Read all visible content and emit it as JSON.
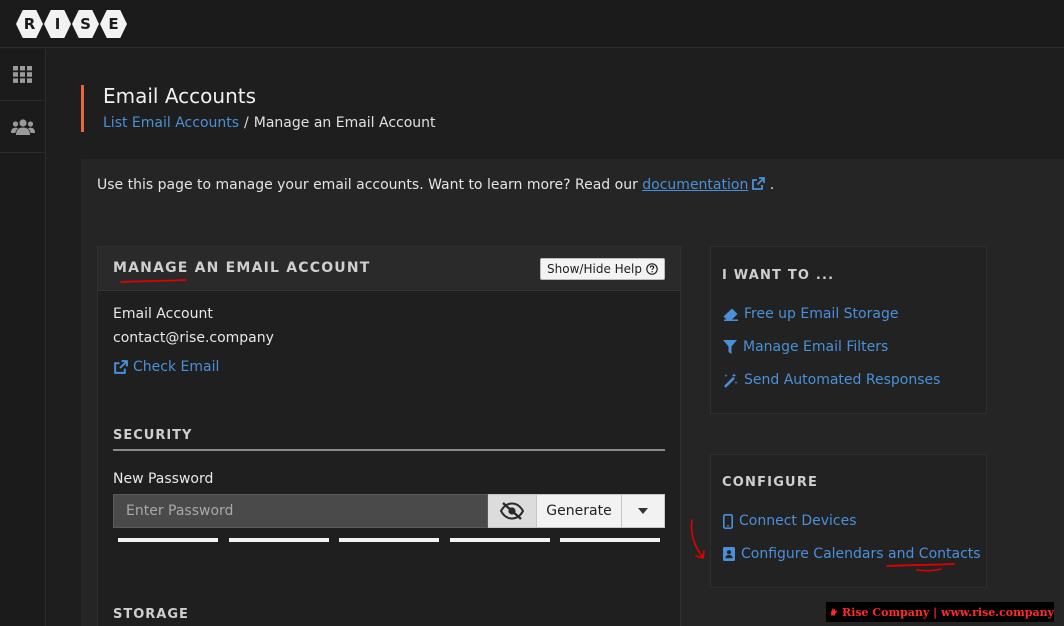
{
  "logo": {
    "letters": [
      "R",
      "I",
      "S",
      "E"
    ]
  },
  "sidebar": {
    "items": [
      {
        "icon": "grid-icon"
      },
      {
        "icon": "users-icon"
      }
    ]
  },
  "header": {
    "title": "Email Accounts",
    "breadcrumb": {
      "link": "List Email Accounts",
      "separator": "/",
      "current": "Manage an Email Account"
    }
  },
  "intro": {
    "text": "Use this page to manage your email accounts. Want to learn more? Read our ",
    "link": "documentation",
    "suffix": "."
  },
  "manage": {
    "title": "MANAGE AN EMAIL ACCOUNT",
    "help_button": "Show/Hide Help",
    "account_label": "Email Account",
    "account_value": "contact@rise.company",
    "check_email": "Check Email",
    "security_title": "SECURITY",
    "password_label": "New Password",
    "password_placeholder": "Enter Password",
    "generate_label": "Generate",
    "storage_title": "STORAGE"
  },
  "want_to": {
    "title": "I WANT TO ...",
    "links": [
      "Free up Email Storage",
      "Manage Email Filters",
      "Send Automated Responses"
    ]
  },
  "configure": {
    "title": "CONFIGURE",
    "links": [
      "Connect Devices",
      "Configure Calendars and Contacts"
    ]
  },
  "watermark": {
    "text": "Rise Company | www.rise.company"
  },
  "colors": {
    "accent": "#e8683a",
    "link": "#4a90d9",
    "annotation": "#e00000"
  }
}
